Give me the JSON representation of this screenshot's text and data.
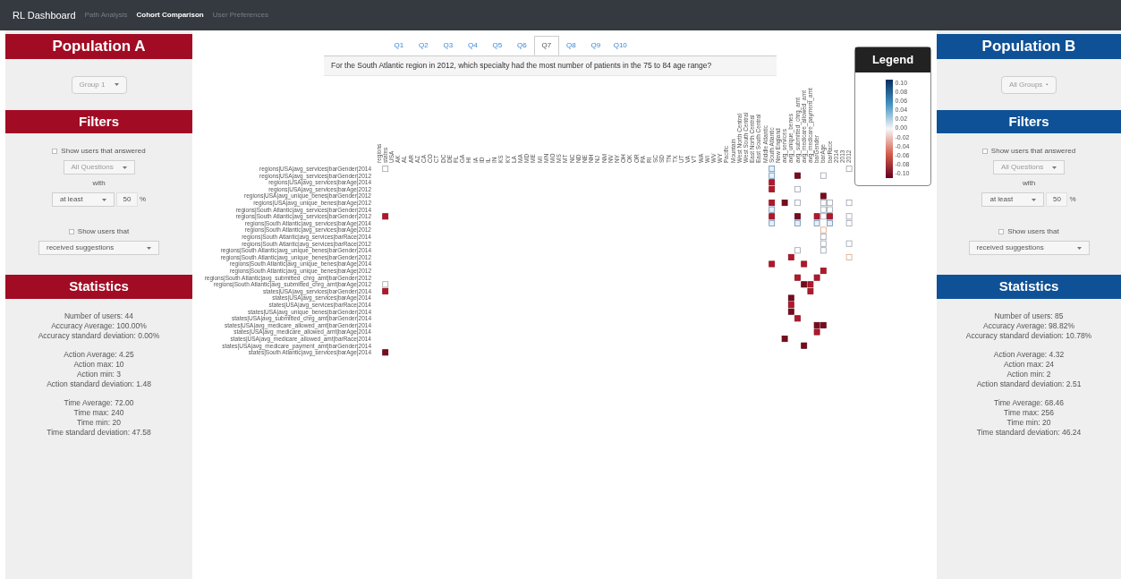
{
  "navbar": {
    "brand": "RL Dashboard",
    "links": [
      {
        "label": "Path Analysis",
        "selected": false
      },
      {
        "label": "Cohort Comparison",
        "selected": true
      },
      {
        "label": "User Preferences",
        "selected": false
      }
    ]
  },
  "populations": [
    {
      "title": "Population A",
      "color": "#a10c24",
      "group": "Group 1",
      "filters_title": "Filters",
      "answered": {
        "label": "Show users that answered",
        "checked": false
      },
      "questions": "All Questions",
      "with": "with",
      "comparison": "at least",
      "percent": "50",
      "percent_unit": "%",
      "show_users": {
        "label": "Show users that",
        "checked": false
      },
      "action": "received suggestions",
      "stats_title": "Statistics",
      "stats": [
        [
          "Number of users: 44",
          "Accuracy Average: 100.00%",
          "Accuracy standard deviation: 0.00%"
        ],
        [
          "Action Average: 4.25",
          "Action max: 10",
          "Action min: 3",
          "Action standard deviation: 1.48"
        ],
        [
          "Time Average: 72.00",
          "Time max: 240",
          "Time min: 20",
          "Time standard deviation: 47.58"
        ]
      ]
    },
    {
      "title": "Population B",
      "color": "#0f5196",
      "group": "All Groups",
      "filters_title": "Filters",
      "answered": {
        "label": "Show users that answered",
        "checked": false
      },
      "questions": "All Questions",
      "with": "with",
      "comparison": "at least",
      "percent": "50",
      "percent_unit": "%",
      "show_users": {
        "label": "Show users that",
        "checked": false
      },
      "action": "received suggestions",
      "stats_title": "Statistics",
      "stats": [
        [
          "Number of users: 85",
          "Accuracy Average: 98.82%",
          "Accuracy standard deviation: 10.78%"
        ],
        [
          "Action Average: 4.32",
          "Action max: 24",
          "Action min: 2",
          "Action standard deviation: 2.51"
        ],
        [
          "Time Average: 68.46",
          "Time max: 256",
          "Time min: 20",
          "Time standard deviation: 46.24"
        ]
      ]
    }
  ],
  "question_tabs": [
    {
      "label": "Q1",
      "selected": false
    },
    {
      "label": "Q2",
      "selected": false
    },
    {
      "label": "Q3",
      "selected": false
    },
    {
      "label": "Q4",
      "selected": false
    },
    {
      "label": "Q5",
      "selected": false
    },
    {
      "label": "Q6",
      "selected": false
    },
    {
      "label": "Q7",
      "selected": true
    },
    {
      "label": "Q8",
      "selected": false
    },
    {
      "label": "Q9",
      "selected": false
    },
    {
      "label": "Q10",
      "selected": false
    }
  ],
  "question": "For the South Atlantic region in 2012, which specialty had the most number of patients in the 75 to 84 age range?",
  "heatmap": {
    "columns": [
      "regions",
      "states",
      "USA",
      "AK",
      "AL",
      "AR",
      "AZ",
      "CA",
      "CO",
      "CT",
      "DC",
      "DE",
      "FL",
      "GA",
      "HI",
      "IA",
      "ID",
      "IL",
      "IN",
      "KS",
      "KY",
      "LA",
      "MA",
      "MD",
      "ME",
      "MI",
      "MN",
      "MO",
      "MS",
      "MT",
      "NC",
      "ND",
      "NE",
      "NH",
      "NJ",
      "NM",
      "NV",
      "NY",
      "OH",
      "OK",
      "OR",
      "PA",
      "RI",
      "SC",
      "SD",
      "TN",
      "TX",
      "UT",
      "VA",
      "VT",
      "WA",
      "WI",
      "WV",
      "WY",
      "Pacific",
      "Mountain",
      "West North Central",
      "West South Central",
      "East North Central",
      "East South Central",
      "Middle Atlantic",
      "South Atlantic",
      "New England",
      "avg_services",
      "avg_unique_benes",
      "avg_submitted_chrg_amt",
      "avg_medicare_allowed_amt",
      "avg_medicare_payment_amt",
      "barGender",
      "barAge",
      "barRace",
      "2014",
      "2013",
      "2012"
    ],
    "rows": [
      "regions|USA|avg_services|barGender|2014",
      "regions|USA|avg_services|barGender|2012",
      "regions|USA|avg_services|barAge|2014",
      "regions|USA|avg_services|barAge|2012",
      "regions|USA|avg_unique_benes|barGender|2012",
      "regions|USA|avg_unique_benes|barAge|2012",
      "regions|South Atlantic|avg_services|barGender|2014",
      "regions|South Atlantic|avg_services|barGender|2012",
      "regions|South Atlantic|avg_services|barAge|2014",
      "regions|South Atlantic|avg_services|barAge|2012",
      "regions|South Atlantic|avg_services|barRace|2014",
      "regions|South Atlantic|avg_services|barRace|2012",
      "regions|South Atlantic|avg_unique_benes|barGender|2014",
      "regions|South Atlantic|avg_unique_benes|barGender|2012",
      "regions|South Atlantic|avg_unique_benes|barAge|2014",
      "regions|South Atlantic|avg_unique_benes|barAge|2012",
      "regions|South Atlantic|avg_submitted_chrg_amt|barGender|2012",
      "regions|South Atlantic|avg_submitted_chrg_amt|barAge|2012",
      "states|USA|avg_services|barGender|2014",
      "states|USA|avg_services|barAge|2014",
      "states|USA|avg_services|barRace|2014",
      "states|USA|avg_unique_benes|barGender|2014",
      "states|USA|avg_submitted_chrg_amt|barGender|2014",
      "states|USA|avg_medicare_allowed_amt|barGender|2014",
      "states|USA|avg_medicare_allowed_amt|barAge|2014",
      "states|USA|avg_medicare_allowed_amt|barRace|2014",
      "states|USA|avg_medicare_payment_amt|barGender|2014",
      "states|South Atlantic|avg_services|barAge|2014"
    ]
  },
  "legend": {
    "title": "Legend",
    "ticks": [
      "0.10",
      "0.08",
      "0.06",
      "0.04",
      "0.02",
      "0.00",
      "-0.02",
      "-0.04",
      "-0.06",
      "-0.08",
      "-0.10"
    ]
  }
}
